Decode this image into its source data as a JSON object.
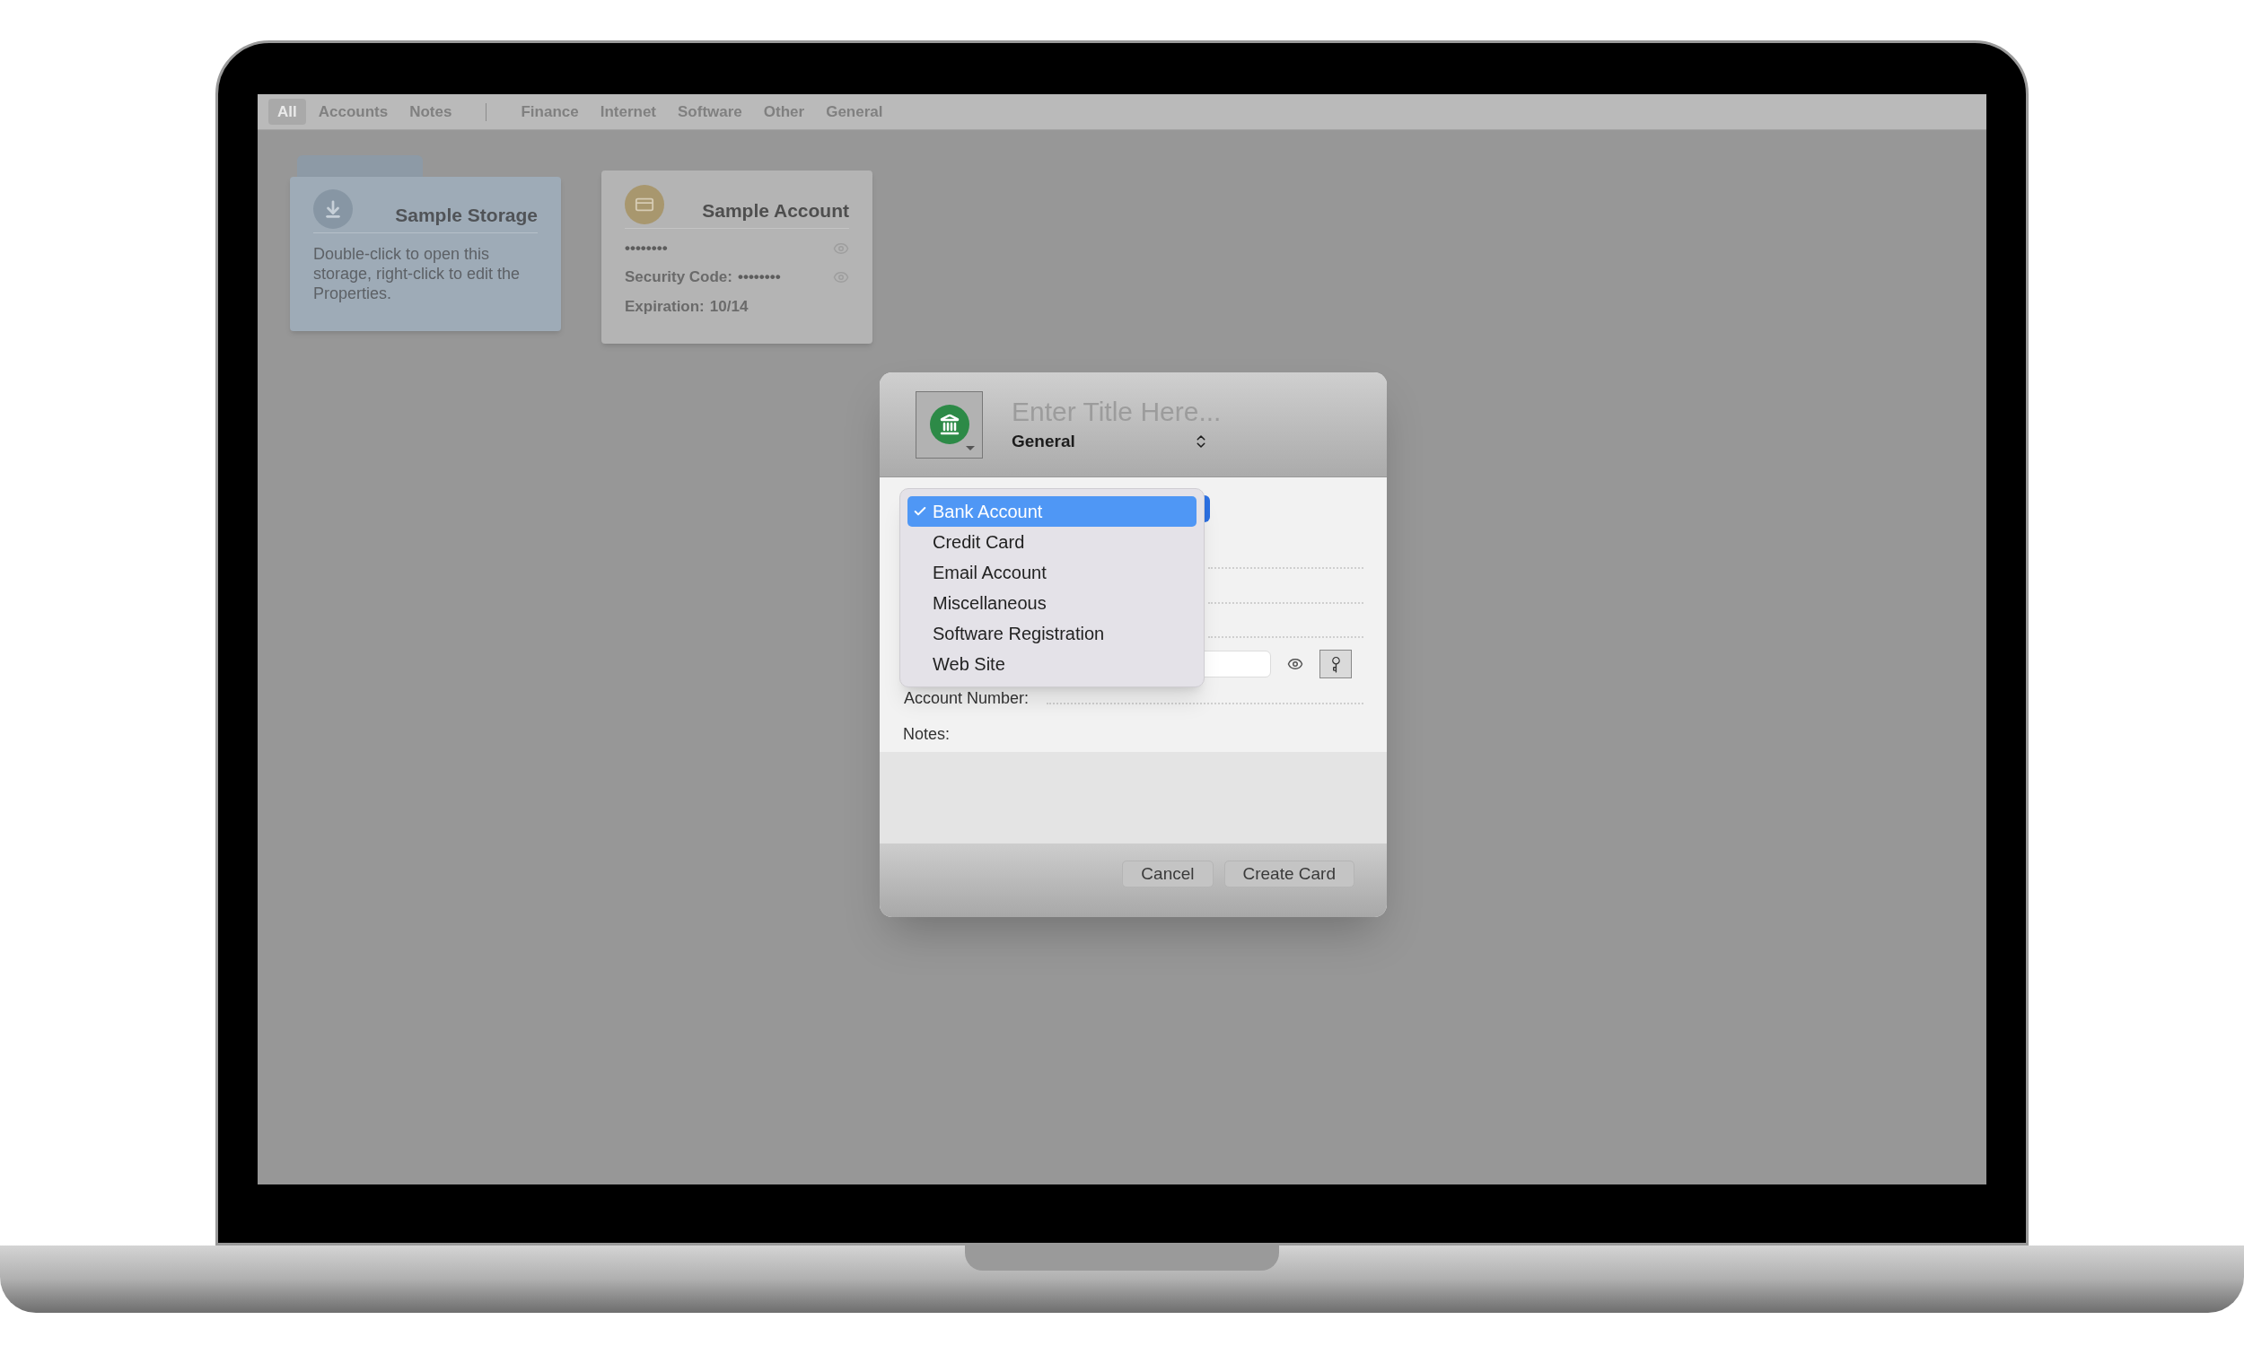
{
  "toolbar": {
    "filters": [
      {
        "label": "All",
        "selected": true
      },
      {
        "label": "Accounts",
        "selected": false
      },
      {
        "label": "Notes",
        "selected": false
      }
    ],
    "categories": [
      {
        "label": "Finance",
        "selected": false
      },
      {
        "label": "Internet",
        "selected": false
      },
      {
        "label": "Software",
        "selected": false
      },
      {
        "label": "Other",
        "selected": false
      },
      {
        "label": "General",
        "selected": false
      }
    ]
  },
  "cards": [
    {
      "kind": "storage",
      "title": "Sample Storage",
      "description": "Double-click to open this storage, right-click to edit the Properties."
    },
    {
      "kind": "account",
      "title": "Sample Account",
      "password": "••••••••",
      "security_label": "Security Code:",
      "security_value": "••••••••",
      "expiration_label": "Expiration:",
      "expiration_value": "10/14"
    }
  ],
  "dialog": {
    "title_placeholder": "Enter Title Here...",
    "group": "General",
    "menu": [
      {
        "label": "Bank Account",
        "selected": true
      },
      {
        "label": "Credit Card",
        "selected": false
      },
      {
        "label": "Email Account",
        "selected": false
      },
      {
        "label": "Miscellaneous",
        "selected": false
      },
      {
        "label": "Software Registration",
        "selected": false
      },
      {
        "label": "Web Site",
        "selected": false
      }
    ],
    "account_number_label": "Account Number:",
    "notes_label": "Notes:",
    "buttons": [
      {
        "label": "Cancel"
      },
      {
        "label": "Create Card"
      }
    ]
  }
}
